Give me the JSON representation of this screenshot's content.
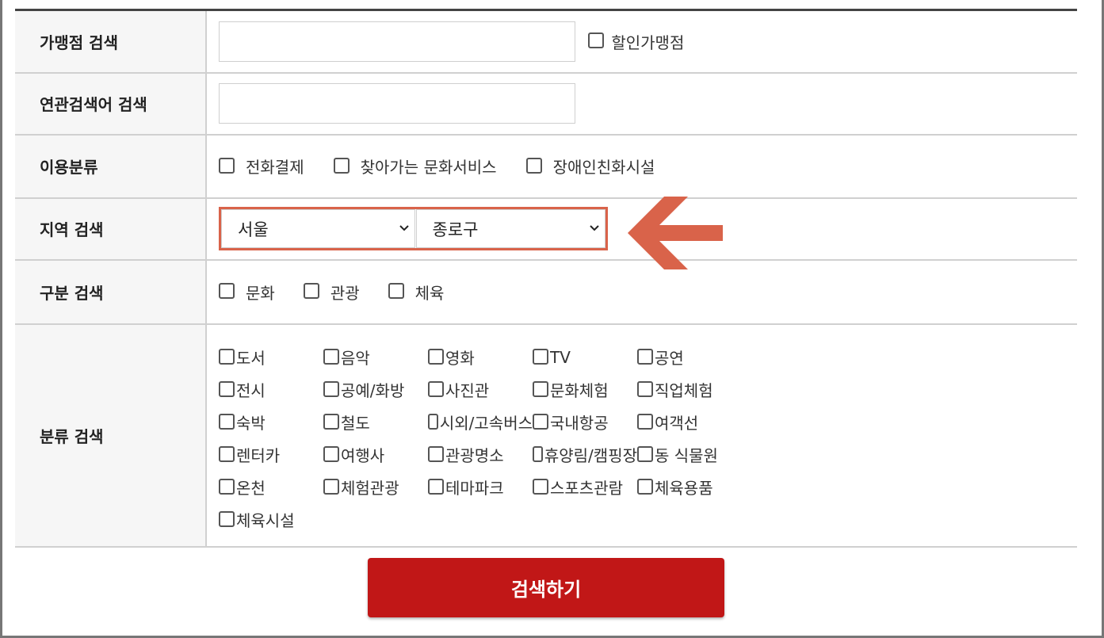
{
  "fields": {
    "store_search": {
      "label": "가맹점 검색",
      "value": "",
      "discount_label": "할인가맹점"
    },
    "related_search": {
      "label": "연관검색어 검색",
      "value": ""
    },
    "usage_category": {
      "label": "이용분류",
      "options": [
        "전화결제",
        "찾아가는 문화서비스",
        "장애인친화시설"
      ]
    },
    "region": {
      "label": "지역 검색",
      "city": "서울",
      "district": "종로구"
    },
    "type_search": {
      "label": "구분 검색",
      "options": [
        "문화",
        "관광",
        "체육"
      ]
    },
    "category_search": {
      "label": "분류 검색",
      "items": [
        "도서",
        "음악",
        "영화",
        "TV",
        "공연",
        "전시",
        "공예/화방",
        "사진관",
        "문화체험",
        "직업체험",
        "숙박",
        "철도",
        "시외/고속버스",
        "국내항공",
        "여객선",
        "렌터카",
        "여행사",
        "관광명소",
        "휴양림/캠핑장",
        "동 식물원",
        "온천",
        "체험관광",
        "테마파크",
        "스포츠관람",
        "체육용품",
        "체육시설"
      ]
    }
  },
  "search_button": "검색하기",
  "colors": {
    "highlight": "#d9634a",
    "button": "#c11717"
  },
  "icons": {
    "annotation": "left-arrow-icon",
    "dropdown": "chevron-down-icon"
  }
}
